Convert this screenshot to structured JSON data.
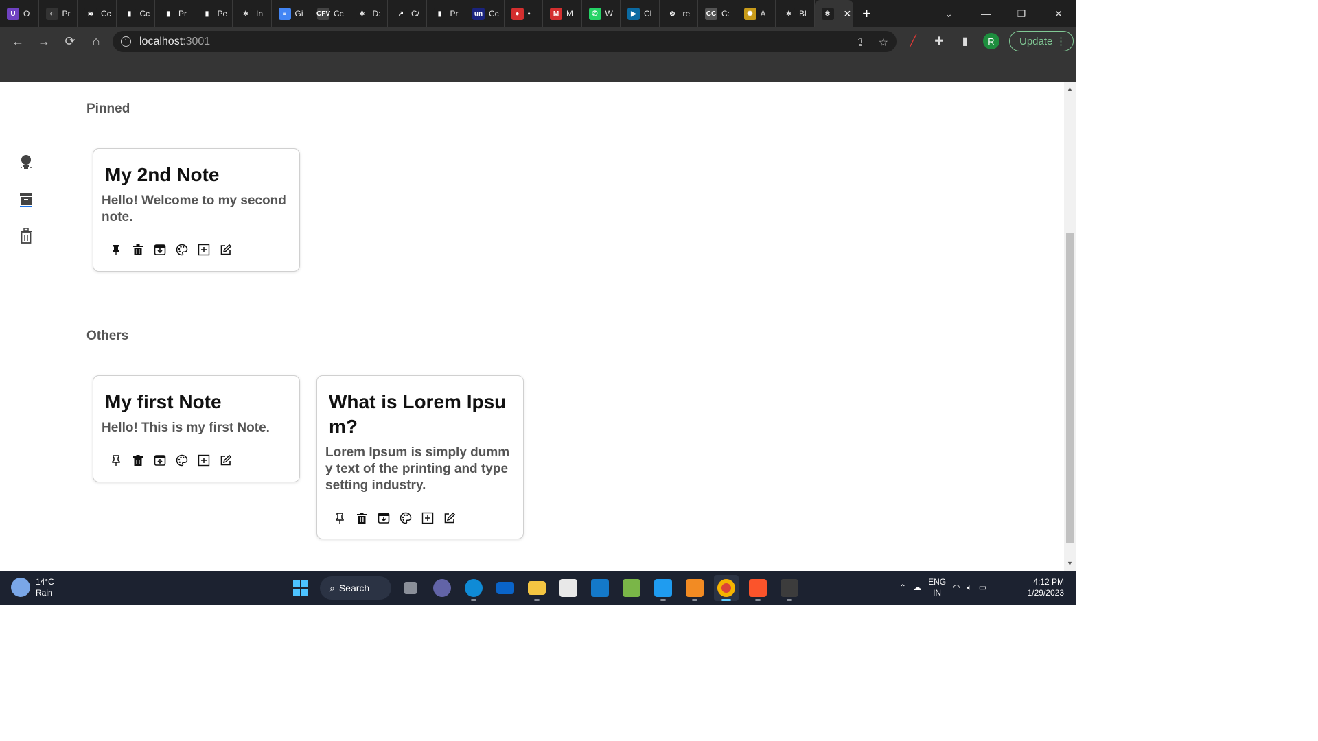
{
  "browser": {
    "tabs": [
      {
        "label": "O",
        "color": "#6f42c1",
        "glyph": "U"
      },
      {
        "label": "Pr",
        "color": "#333333",
        "glyph": "◐"
      },
      {
        "label": "Cc",
        "color": "#1f1f1f",
        "glyph": "≋"
      },
      {
        "label": "Cc",
        "color": "#1f1f1f",
        "glyph": "▮"
      },
      {
        "label": "Pr",
        "color": "#1f1f1f",
        "glyph": "▮"
      },
      {
        "label": "Pe",
        "color": "#1f1f1f",
        "glyph": "▮"
      },
      {
        "label": "In",
        "color": "#1f1f1f",
        "glyph": "⚛"
      },
      {
        "label": "Gi",
        "color": "#4285f4",
        "glyph": "≡"
      },
      {
        "label": "Cc",
        "color": "#444444",
        "glyph": "CFV"
      },
      {
        "label": "D:",
        "color": "#1f1f1f",
        "glyph": "⚛"
      },
      {
        "label": "C/",
        "color": "#1f1f1f",
        "glyph": "↗"
      },
      {
        "label": "Pr",
        "color": "#1f1f1f",
        "glyph": "▮"
      },
      {
        "label": "Cc",
        "color": "#1a237e",
        "glyph": "un"
      },
      {
        "label": "•",
        "color": "#d32f2f",
        "glyph": "●"
      },
      {
        "label": "M",
        "color": "#d32f2f",
        "glyph": "M"
      },
      {
        "label": "W",
        "color": "#25d366",
        "glyph": "✆"
      },
      {
        "label": "Cl",
        "color": "#0b6aa2",
        "glyph": "▶"
      },
      {
        "label": "re",
        "color": "#1f1f1f",
        "glyph": "⊚"
      },
      {
        "label": "C:",
        "color": "#555555",
        "glyph": "CC"
      },
      {
        "label": "A",
        "color": "#c89b1a",
        "glyph": "✺"
      },
      {
        "label": "Bl",
        "color": "#1f1f1f",
        "glyph": "⚛"
      },
      {
        "label": "",
        "color": "#1f1f1f",
        "glyph": "⚛",
        "active": true
      }
    ],
    "url_host": "localhost",
    "url_port": ":3001",
    "profile_initial": "R",
    "update_label": "Update"
  },
  "notes_app": {
    "pinned_title": "Pinned",
    "others_title": "Others",
    "pinned_notes": [
      {
        "title": "My 2nd Note",
        "content": "Hello! Welcome to my second note."
      }
    ],
    "other_notes": [
      {
        "title": "My first Note",
        "content": "Hello! This is my first Note."
      },
      {
        "title": "What is Lorem Ipsum?",
        "content": "Lorem Ipsum is simply dummy text of the printing and typesetting industry."
      }
    ]
  },
  "taskbar": {
    "temperature": "14°C",
    "weather": "Rain",
    "search_label": "Search",
    "language": "ENG",
    "region": "IN",
    "time": "4:12 PM",
    "date": "1/29/2023"
  }
}
